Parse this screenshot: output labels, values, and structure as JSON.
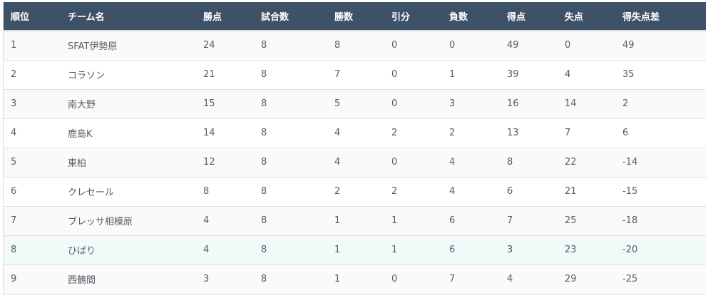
{
  "table": {
    "headers": [
      "順位",
      "チーム名",
      "勝点",
      "試合数",
      "勝数",
      "引分",
      "負数",
      "得点",
      "失点",
      "得失点差"
    ],
    "rows": [
      [
        "1",
        "SFAT伊勢原",
        "24",
        "8",
        "8",
        "0",
        "0",
        "49",
        "0",
        "49"
      ],
      [
        "2",
        "コラソン",
        "21",
        "8",
        "7",
        "0",
        "1",
        "39",
        "4",
        "35"
      ],
      [
        "3",
        "南大野",
        "15",
        "8",
        "5",
        "0",
        "3",
        "16",
        "14",
        "2"
      ],
      [
        "4",
        "鹿島K",
        "14",
        "8",
        "4",
        "2",
        "2",
        "13",
        "7",
        "6"
      ],
      [
        "5",
        "東柏",
        "12",
        "8",
        "4",
        "0",
        "4",
        "8",
        "22",
        "-14"
      ],
      [
        "6",
        "クレセール",
        "8",
        "8",
        "2",
        "2",
        "4",
        "6",
        "21",
        "-15"
      ],
      [
        "7",
        "ブレッサ相模原",
        "4",
        "8",
        "1",
        "1",
        "6",
        "7",
        "25",
        "-18"
      ],
      [
        "8",
        "ひばり",
        "4",
        "8",
        "1",
        "1",
        "6",
        "3",
        "23",
        "-20"
      ],
      [
        "9",
        "西鶴間",
        "3",
        "8",
        "1",
        "0",
        "7",
        "4",
        "29",
        "-25"
      ]
    ]
  },
  "colors": {
    "header_bg": "#3f5167",
    "header_text": "#ffffff",
    "row_odd": "#fafafa",
    "row_even": "#ffffff",
    "row_highlight": "#f1faf8",
    "cell_text": "#555d66"
  }
}
